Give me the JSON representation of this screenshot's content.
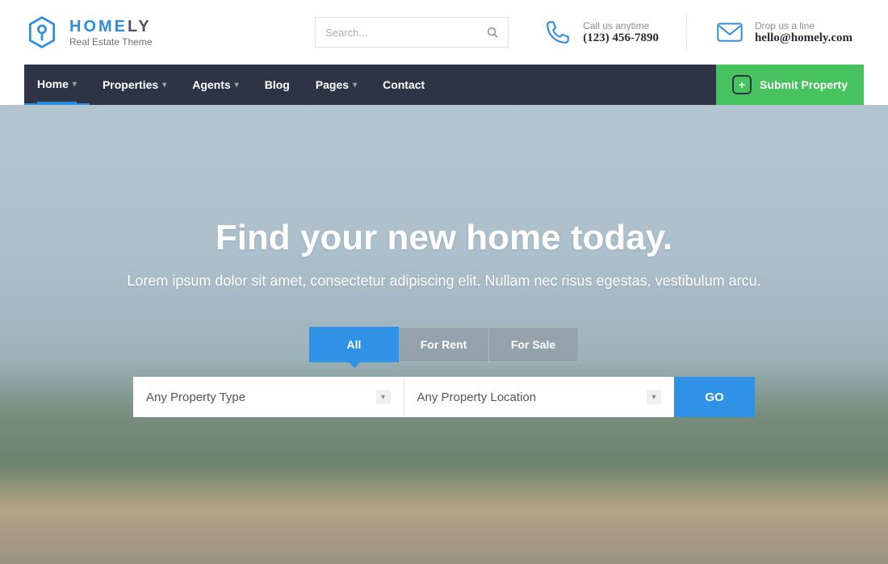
{
  "brand": {
    "title_a": "HOME",
    "title_b": "LY",
    "subtitle": "Real Estate Theme"
  },
  "search": {
    "placeholder": "Search..."
  },
  "contacts": {
    "phone": {
      "label": "Call us anytime",
      "value": "(123) 456-7890"
    },
    "email": {
      "label": "Drop us a line",
      "value": "hello@homely.com"
    }
  },
  "nav": {
    "items": [
      "Home",
      "Properties",
      "Agents",
      "Blog",
      "Pages",
      "Contact"
    ],
    "submit": "Submit Property"
  },
  "hero": {
    "title": "Find your new home today.",
    "subtitle": "Lorem ipsum dolor sit amet, consectetur adipiscing elit. Nullam nec risus egestas, vestibulum arcu.",
    "tabs": [
      "All",
      "For Rent",
      "For Sale"
    ],
    "prop_type": "Any Property Type",
    "prop_location": "Any Property Location",
    "go": "GO"
  }
}
